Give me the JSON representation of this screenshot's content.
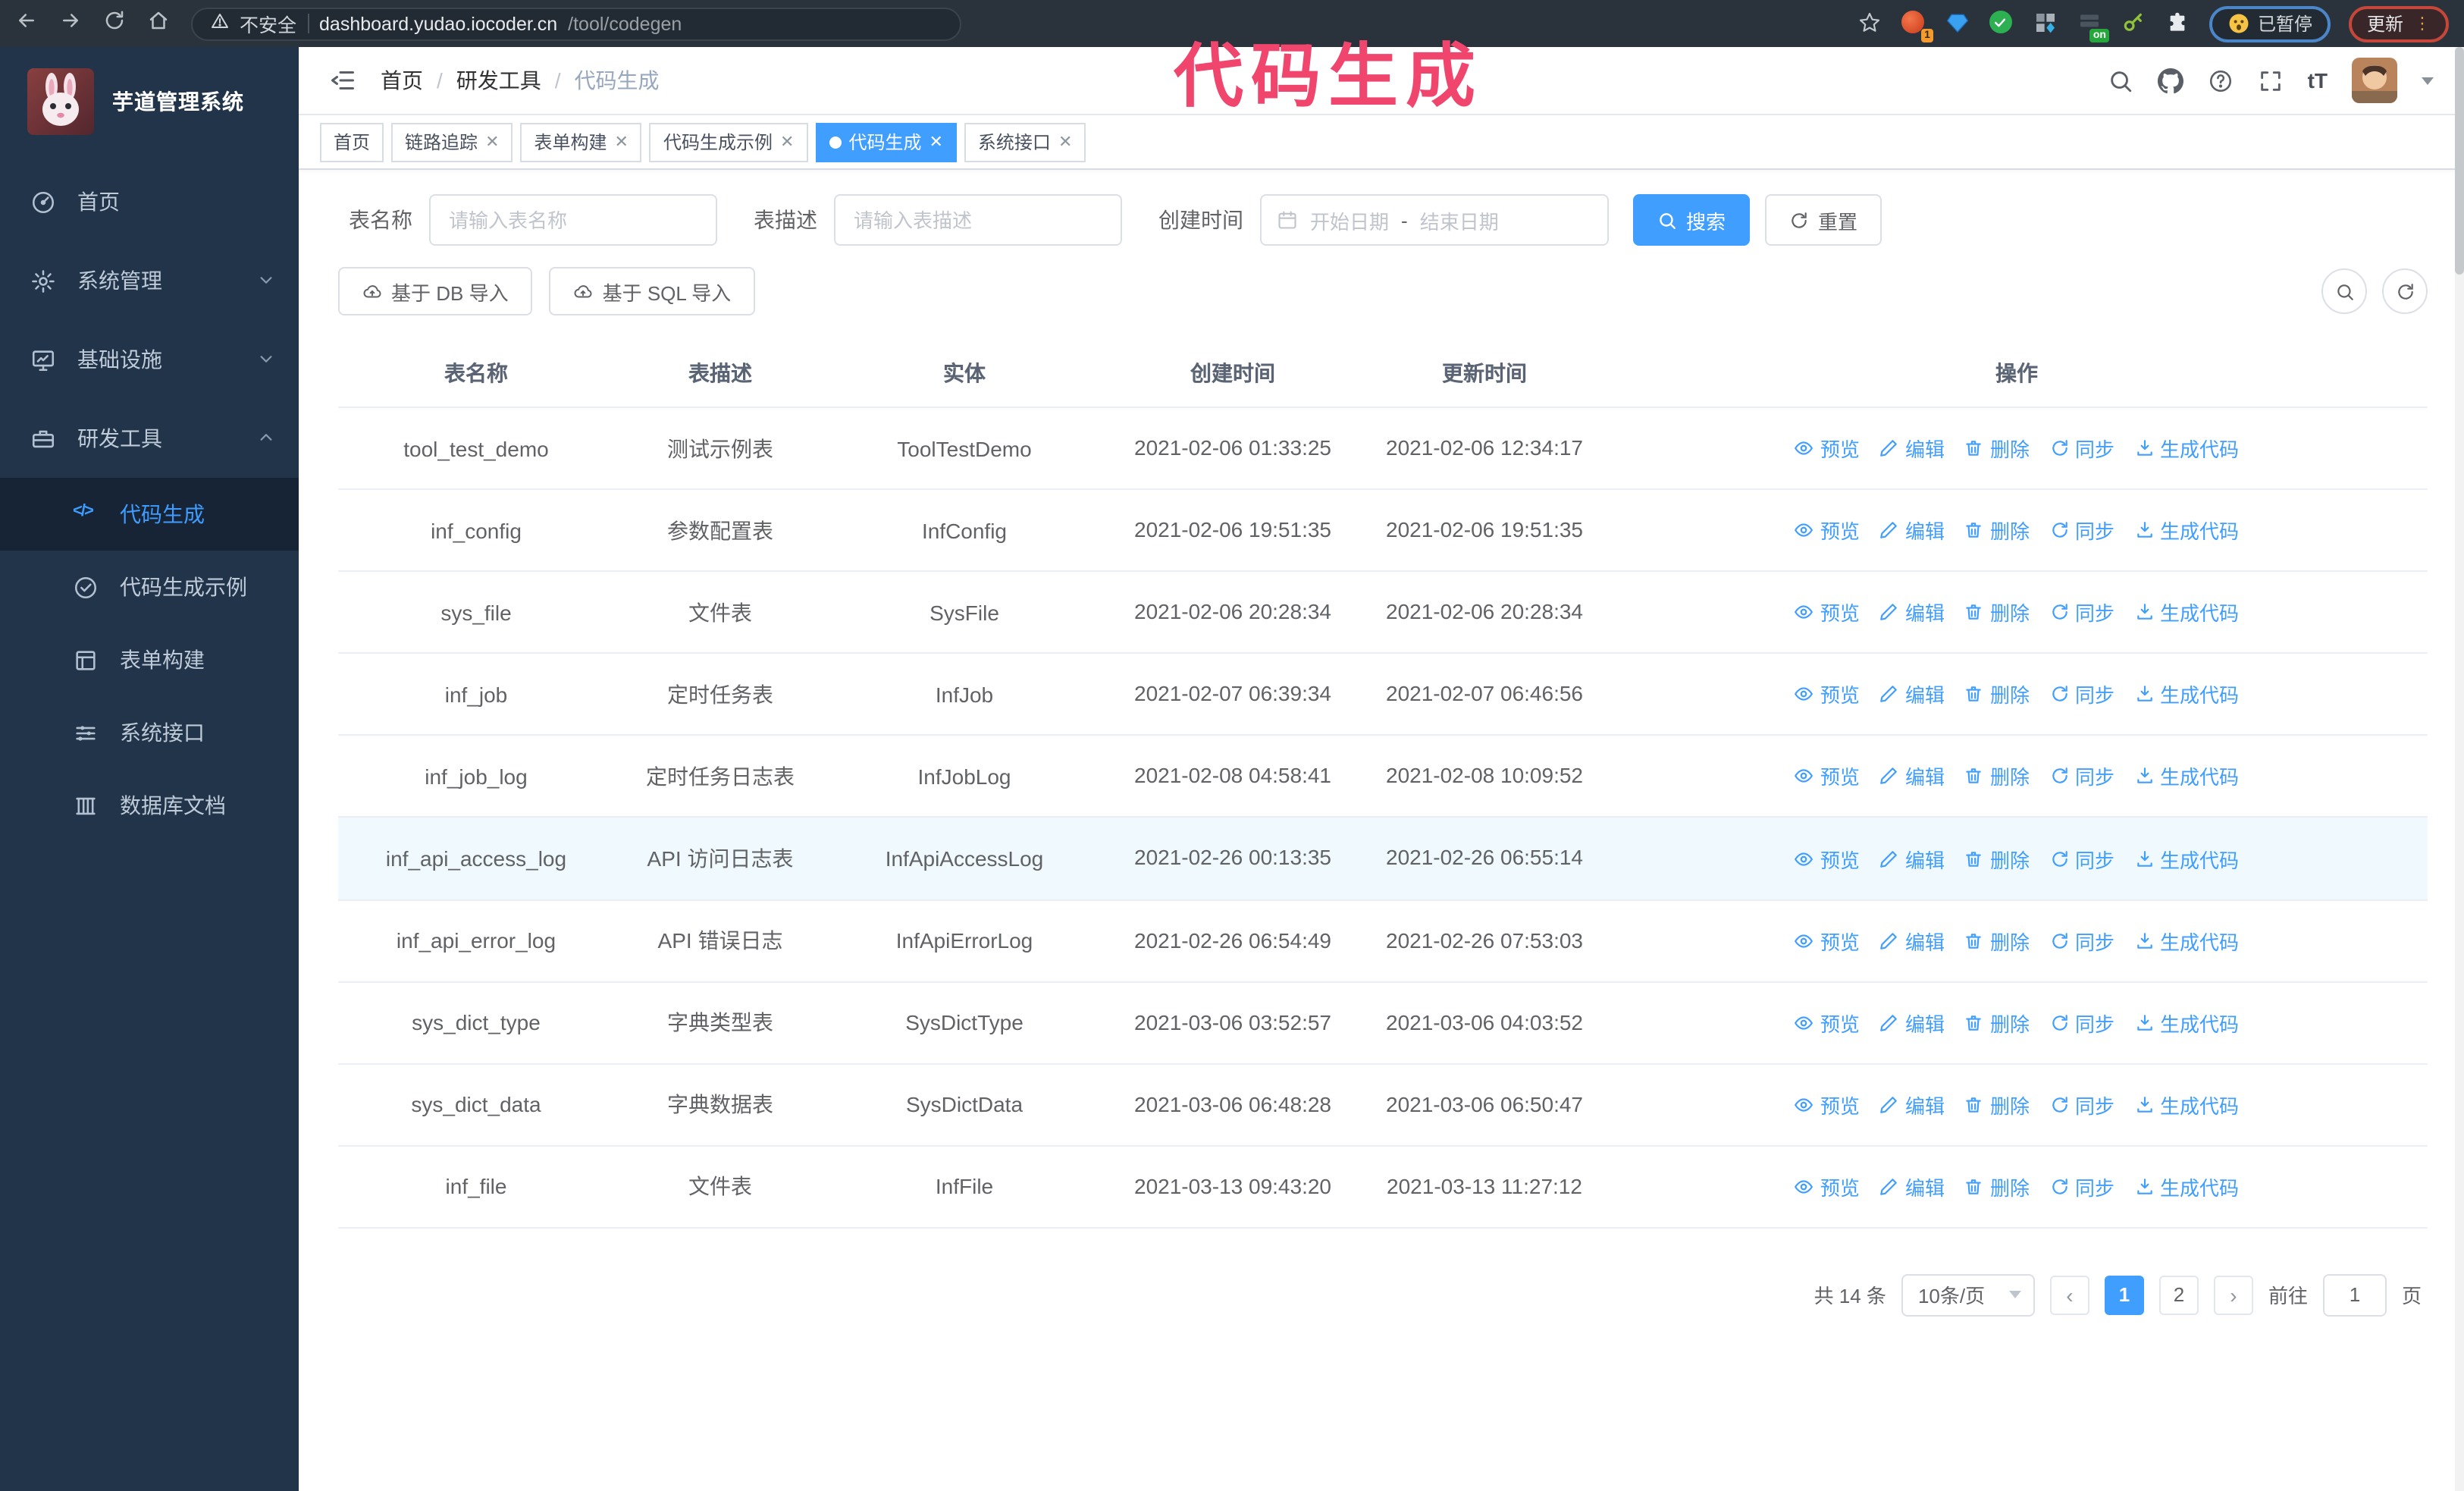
{
  "browser": {
    "security_label": "不安全",
    "url_host": "dashboard.yudao.iocoder.cn",
    "url_path": "/tool/codegen",
    "ext_badge": "1",
    "ext_on_badge": "on",
    "paused_label": "已暂停",
    "update_label": "更新"
  },
  "annotation": {
    "text": "代码生成",
    "color": "#f0466e"
  },
  "sidebar": {
    "title": "芋道管理系统",
    "items": [
      {
        "label": "首页",
        "icon": "dashboard-icon"
      },
      {
        "label": "系统管理",
        "icon": "gear-icon"
      },
      {
        "label": "基础设施",
        "icon": "monitor-icon"
      },
      {
        "label": "研发工具",
        "icon": "toolbox-icon"
      }
    ],
    "subitems": [
      {
        "label": "代码生成",
        "icon": "code-icon",
        "active": true
      },
      {
        "label": "代码生成示例",
        "icon": "shield-check-icon"
      },
      {
        "label": "表单构建",
        "icon": "form-icon"
      },
      {
        "label": "系统接口",
        "icon": "sliders-icon"
      },
      {
        "label": "数据库文档",
        "icon": "columns-icon"
      }
    ]
  },
  "breadcrumb": {
    "items": [
      "首页",
      "研发工具",
      "代码生成"
    ]
  },
  "tabs": [
    {
      "label": "首页"
    },
    {
      "label": "链路追踪"
    },
    {
      "label": "表单构建"
    },
    {
      "label": "代码生成示例"
    },
    {
      "label": "代码生成"
    },
    {
      "label": "系统接口"
    }
  ],
  "filters": {
    "name_label": "表名称",
    "name_placeholder": "请输入表名称",
    "desc_label": "表描述",
    "desc_placeholder": "请输入表描述",
    "time_label": "创建时间",
    "start_placeholder": "开始日期",
    "range_separator": "-",
    "end_placeholder": "结束日期",
    "search_label": "搜索",
    "reset_label": "重置"
  },
  "toolbar": {
    "db_import_label": "基于 DB 导入",
    "sql_import_label": "基于 SQL 导入"
  },
  "table": {
    "columns": [
      "表名称",
      "表描述",
      "实体",
      "创建时间",
      "更新时间",
      "操作"
    ],
    "action_labels": [
      {
        "label": "预览",
        "icon": "eye"
      },
      {
        "label": "编辑",
        "icon": "edit"
      },
      {
        "label": "删除",
        "icon": "trash"
      },
      {
        "label": "同步",
        "icon": "sync"
      },
      {
        "label": "生成代码",
        "icon": "download"
      }
    ],
    "rows": [
      {
        "name": "tool_test_demo",
        "desc": "测试示例表",
        "entity": "ToolTestDemo",
        "created": "2021-02-06 01:33:25",
        "updated": "2021-02-06 12:34:17"
      },
      {
        "name": "inf_config",
        "desc": "参数配置表",
        "entity": "InfConfig",
        "created": "2021-02-06 19:51:35",
        "updated": "2021-02-06 19:51:35"
      },
      {
        "name": "sys_file",
        "desc": "文件表",
        "entity": "SysFile",
        "created": "2021-02-06 20:28:34",
        "updated": "2021-02-06 20:28:34"
      },
      {
        "name": "inf_job",
        "desc": "定时任务表",
        "entity": "InfJob",
        "created": "2021-02-07 06:39:34",
        "updated": "2021-02-07 06:46:56"
      },
      {
        "name": "inf_job_log",
        "desc": "定时任务日志表",
        "entity": "InfJobLog",
        "created": "2021-02-08 04:58:41",
        "updated": "2021-02-08 10:09:52"
      },
      {
        "name": "inf_api_access_log",
        "desc": "API 访问日志表",
        "entity": "InfApiAccessLog",
        "created": "2021-02-26 00:13:35",
        "updated": "2021-02-26 06:55:14",
        "highlight": true
      },
      {
        "name": "inf_api_error_log",
        "desc": "API 错误日志",
        "entity": "InfApiErrorLog",
        "created": "2021-02-26 06:54:49",
        "updated": "2021-02-26 07:53:03"
      },
      {
        "name": "sys_dict_type",
        "desc": "字典类型表",
        "entity": "SysDictType",
        "created": "2021-03-06 03:52:57",
        "updated": "2021-03-06 04:03:52"
      },
      {
        "name": "sys_dict_data",
        "desc": "字典数据表",
        "entity": "SysDictData",
        "created": "2021-03-06 06:48:28",
        "updated": "2021-03-06 06:50:47"
      },
      {
        "name": "inf_file",
        "desc": "文件表",
        "entity": "InfFile",
        "created": "2021-03-13 09:43:20",
        "updated": "2021-03-13 11:27:12"
      }
    ]
  },
  "pagination": {
    "total_label": "共 14 条",
    "page_size_label": "10条/页",
    "pages": [
      "1",
      "2"
    ],
    "active_page": "1",
    "goto_label": "前往",
    "goto_value": "1",
    "unit_label": "页"
  }
}
